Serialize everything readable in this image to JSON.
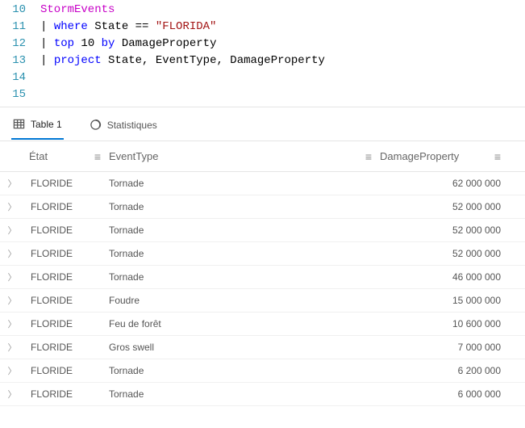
{
  "editor": {
    "lines": [
      {
        "num": "10",
        "tokens": [
          {
            "cls": "tk-table",
            "text": "StormEvents"
          }
        ]
      },
      {
        "num": "11",
        "tokens": [
          {
            "cls": "tk-id",
            "text": "| "
          },
          {
            "cls": "tk-op",
            "text": "where"
          },
          {
            "cls": "tk-id",
            "text": " State == "
          },
          {
            "cls": "tk-str",
            "text": "\"FLORIDA\""
          }
        ]
      },
      {
        "num": "12",
        "tokens": [
          {
            "cls": "tk-id",
            "text": "| "
          },
          {
            "cls": "tk-op",
            "text": "top"
          },
          {
            "cls": "tk-id",
            "text": " 10 "
          },
          {
            "cls": "tk-op",
            "text": "by"
          },
          {
            "cls": "tk-id",
            "text": " DamageProperty"
          }
        ]
      },
      {
        "num": "13",
        "tokens": [
          {
            "cls": "tk-id",
            "text": "| "
          },
          {
            "cls": "tk-op",
            "text": "project"
          },
          {
            "cls": "tk-id",
            "text": " State"
          },
          {
            "cls": "tk-id",
            "text": ", "
          },
          {
            "cls": "tk-id",
            "text": "EventType"
          },
          {
            "cls": "tk-id",
            "text": ", "
          },
          {
            "cls": "tk-id",
            "text": "DamageProperty"
          }
        ]
      },
      {
        "num": "14",
        "tokens": []
      },
      {
        "num": "15",
        "tokens": []
      }
    ]
  },
  "tabs": {
    "table": "Table 1",
    "stats": "Statistiques"
  },
  "columns": {
    "state": "État",
    "event": "EventType",
    "damage": "DamageProperty"
  },
  "chart_data": {
    "type": "table",
    "columns": [
      "État",
      "EventType",
      "DamageProperty"
    ],
    "rows": [
      {
        "state": "FLORIDE",
        "event": "Tornade",
        "damage": "62 000 000"
      },
      {
        "state": "FLORIDE",
        "event": "Tornade",
        "damage": "52 000 000"
      },
      {
        "state": "FLORIDE",
        "event": "Tornade",
        "damage": "52 000 000"
      },
      {
        "state": "FLORIDE",
        "event": "Tornade",
        "damage": "52 000 000"
      },
      {
        "state": "FLORIDE",
        "event": "Tornade",
        "damage": "46 000 000"
      },
      {
        "state": "FLORIDE",
        "event": "Foudre",
        "damage": "15 000 000"
      },
      {
        "state": "FLORIDE",
        "event": "Feu de forêt",
        "damage": "10 600 000"
      },
      {
        "state": "FLORIDE",
        "event": "Gros swell",
        "damage": "7 000 000"
      },
      {
        "state": "FLORIDE",
        "event": "Tornade",
        "damage": "6 200 000"
      },
      {
        "state": "FLORIDE",
        "event": "Tornade",
        "damage": "6 000 000"
      }
    ]
  }
}
